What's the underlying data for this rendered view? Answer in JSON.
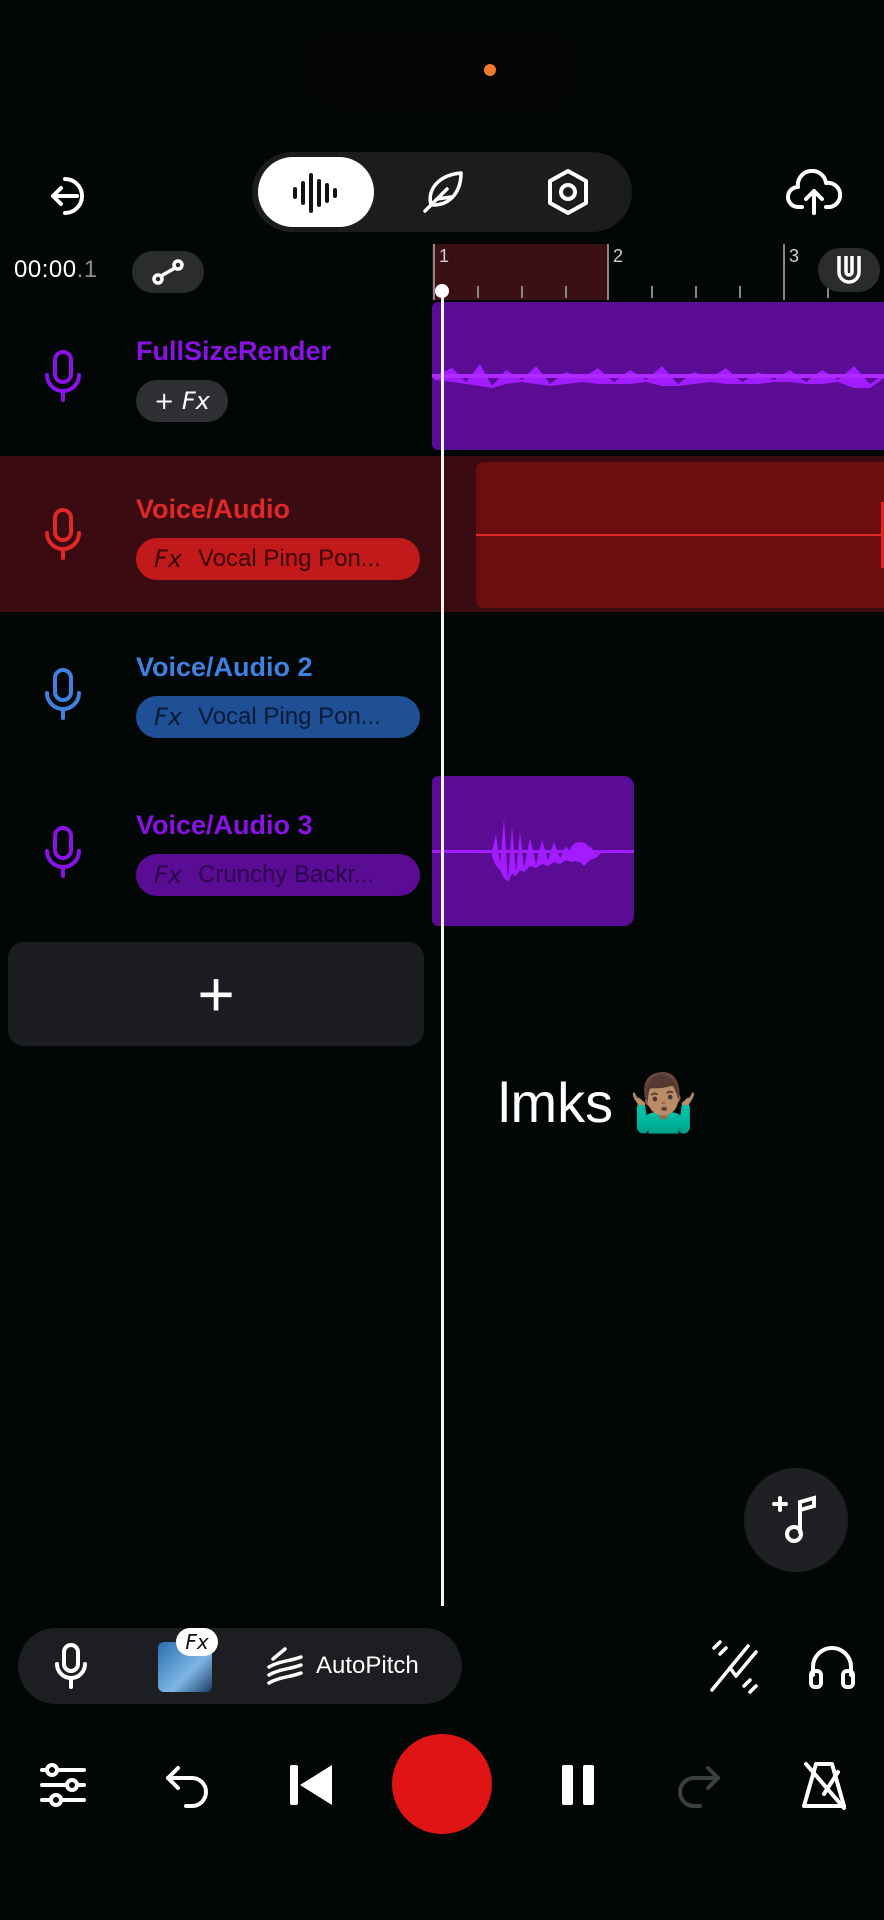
{
  "header": {
    "back_icon": "exit-icon",
    "modes": [
      "waveform-icon",
      "feather-icon",
      "hexagon-settings-icon"
    ],
    "upload_icon": "cloud-upload-icon"
  },
  "timeline": {
    "time_main": "00:00",
    "time_frac": ".1",
    "link_icon": "link-icon",
    "ruler_ticks": [
      "1",
      "2",
      "3"
    ],
    "magnet_icon": "magnet-icon"
  },
  "tracks": [
    {
      "name": "FullSizeRender",
      "fx_label": "+ Fx",
      "effect": "",
      "color": "#8a12e6"
    },
    {
      "name": "Voice/Audio",
      "fx_label": "Fx",
      "effect": "Vocal Ping Pon...",
      "color": "#e02828"
    },
    {
      "name": "Voice/Audio 2",
      "fx_label": "Fx",
      "effect": "Vocal Ping Pon...",
      "color": "#3f80e0"
    },
    {
      "name": "Voice/Audio 3",
      "fx_label": "Fx",
      "effect": "Crunchy Backr...",
      "color": "#8a12e6"
    }
  ],
  "add_track_label": "+",
  "overlay_text": "lmks 🤷🏽‍♂️",
  "bottom_tools": {
    "mic_icon": "mic-icon",
    "fx_badge": "Fx",
    "autopitch_label": "AutoPitch",
    "tuning_icon": "tuning-fork-icon",
    "headphones_icon": "headphones-icon"
  },
  "transport": {
    "mixer_icon": "sliders-icon",
    "undo_icon": "undo-icon",
    "skip_back_icon": "skip-back-icon",
    "record_icon": "record-icon",
    "pause_icon": "pause-icon",
    "redo_icon": "redo-icon",
    "metronome_icon": "metronome-off-icon"
  },
  "colors": {
    "accent_purple": "#8a12e6",
    "accent_red": "#e02828",
    "accent_blue": "#3f80e0",
    "record": "#e01414"
  }
}
